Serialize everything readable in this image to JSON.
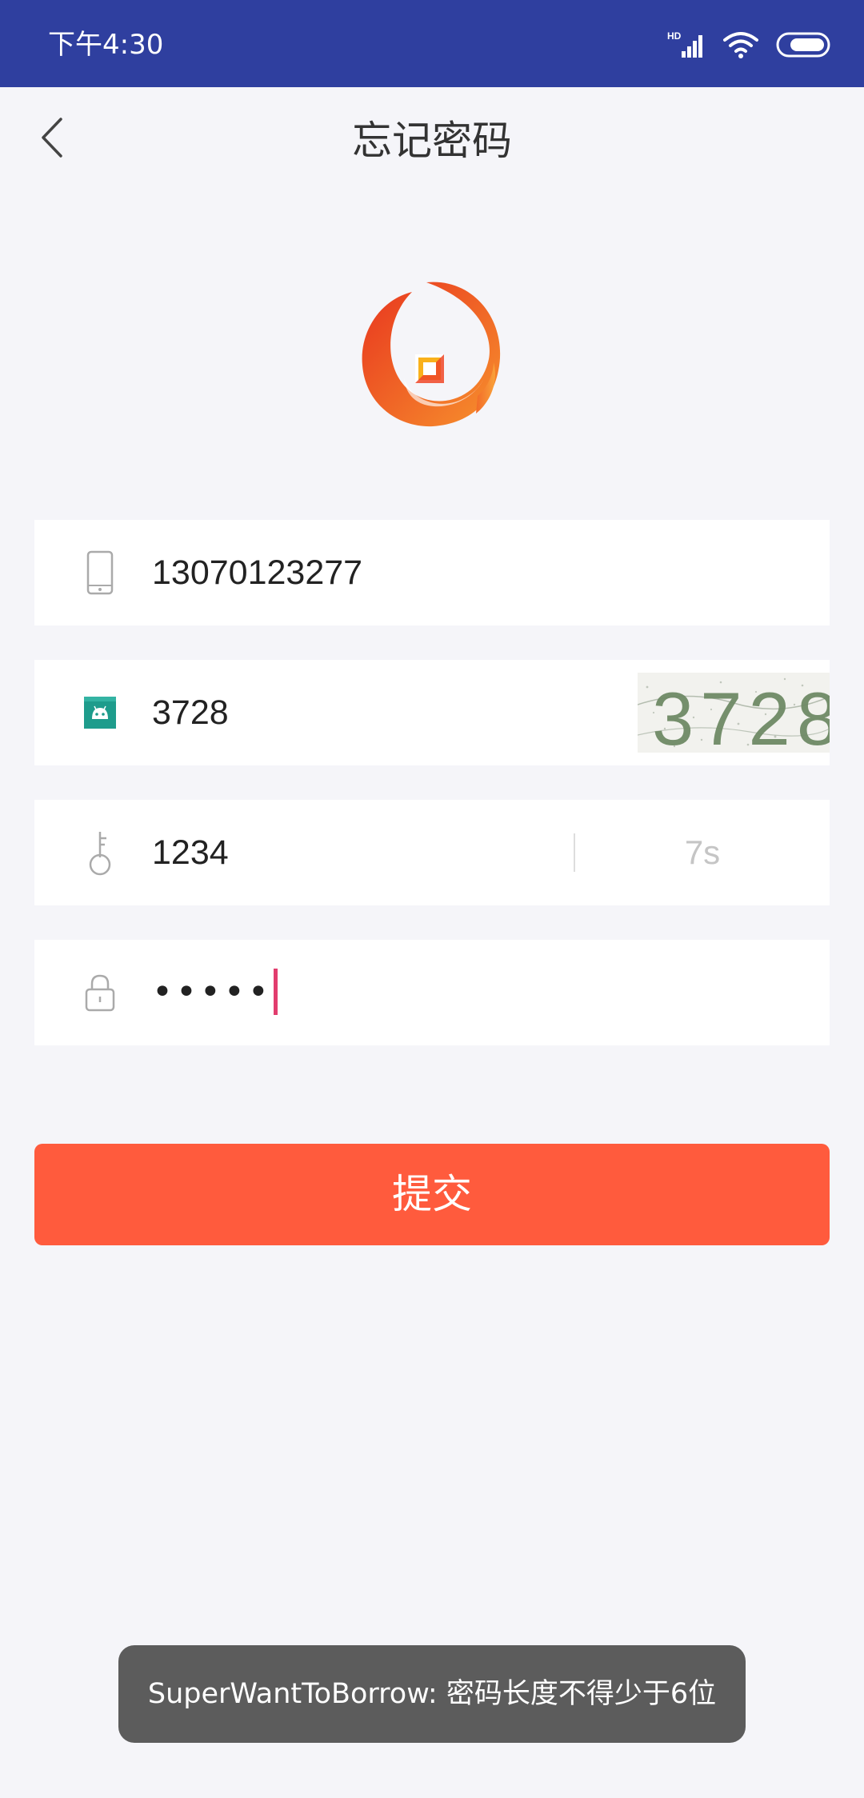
{
  "status_bar": {
    "time": "下午4:30",
    "signal_label": "HD",
    "icons": [
      "signal-icon",
      "wifi-icon",
      "battery-icon"
    ]
  },
  "header": {
    "title": "忘记密码",
    "back_icon": "chevron-left-icon"
  },
  "form": {
    "phone": {
      "value": "13070123277",
      "icon": "phone-icon"
    },
    "captcha": {
      "value": "3728",
      "image_text": "3728",
      "icon": "android-icon"
    },
    "sms_code": {
      "value": "1234",
      "countdown": "7s",
      "icon": "key-icon"
    },
    "password": {
      "masked": "•••••",
      "icon": "lock-icon"
    }
  },
  "submit_label": "提交",
  "toast": "SuperWantToBorrow: 密码长度不得少于6位",
  "colors": {
    "status_bar": "#2f3f9f",
    "background": "#f5f5f9",
    "accent": "#ff5b3d",
    "caret": "#e23d6e",
    "logo_orange": "#f2702a"
  }
}
